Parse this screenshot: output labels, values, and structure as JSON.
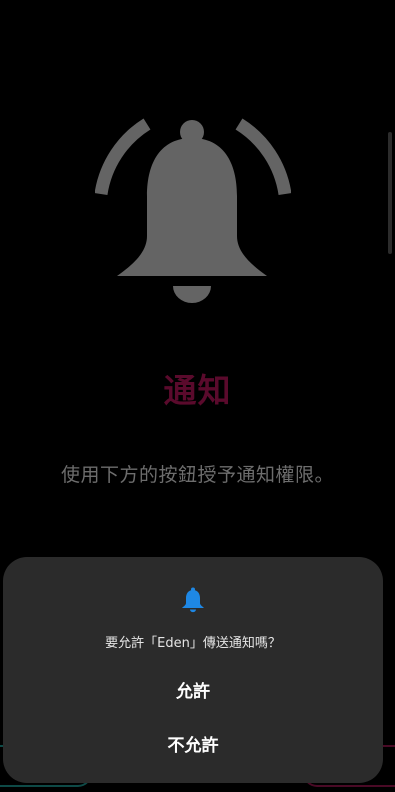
{
  "page": {
    "title": "通知",
    "description": "使用下方的按鈕授予通知權限。"
  },
  "dialog": {
    "question": "要允許「Eden」傳送通知嗎？",
    "allow_label": "允許",
    "deny_label": "不允許"
  },
  "icons": {
    "hero": "bell-icon",
    "dialog": "bell-icon"
  },
  "colors": {
    "background": "#000000",
    "title": "#5a0a2c",
    "dialog_background": "#2b2b2b",
    "dialog_icon": "#1e88e5",
    "hero_icon": "#646464"
  }
}
